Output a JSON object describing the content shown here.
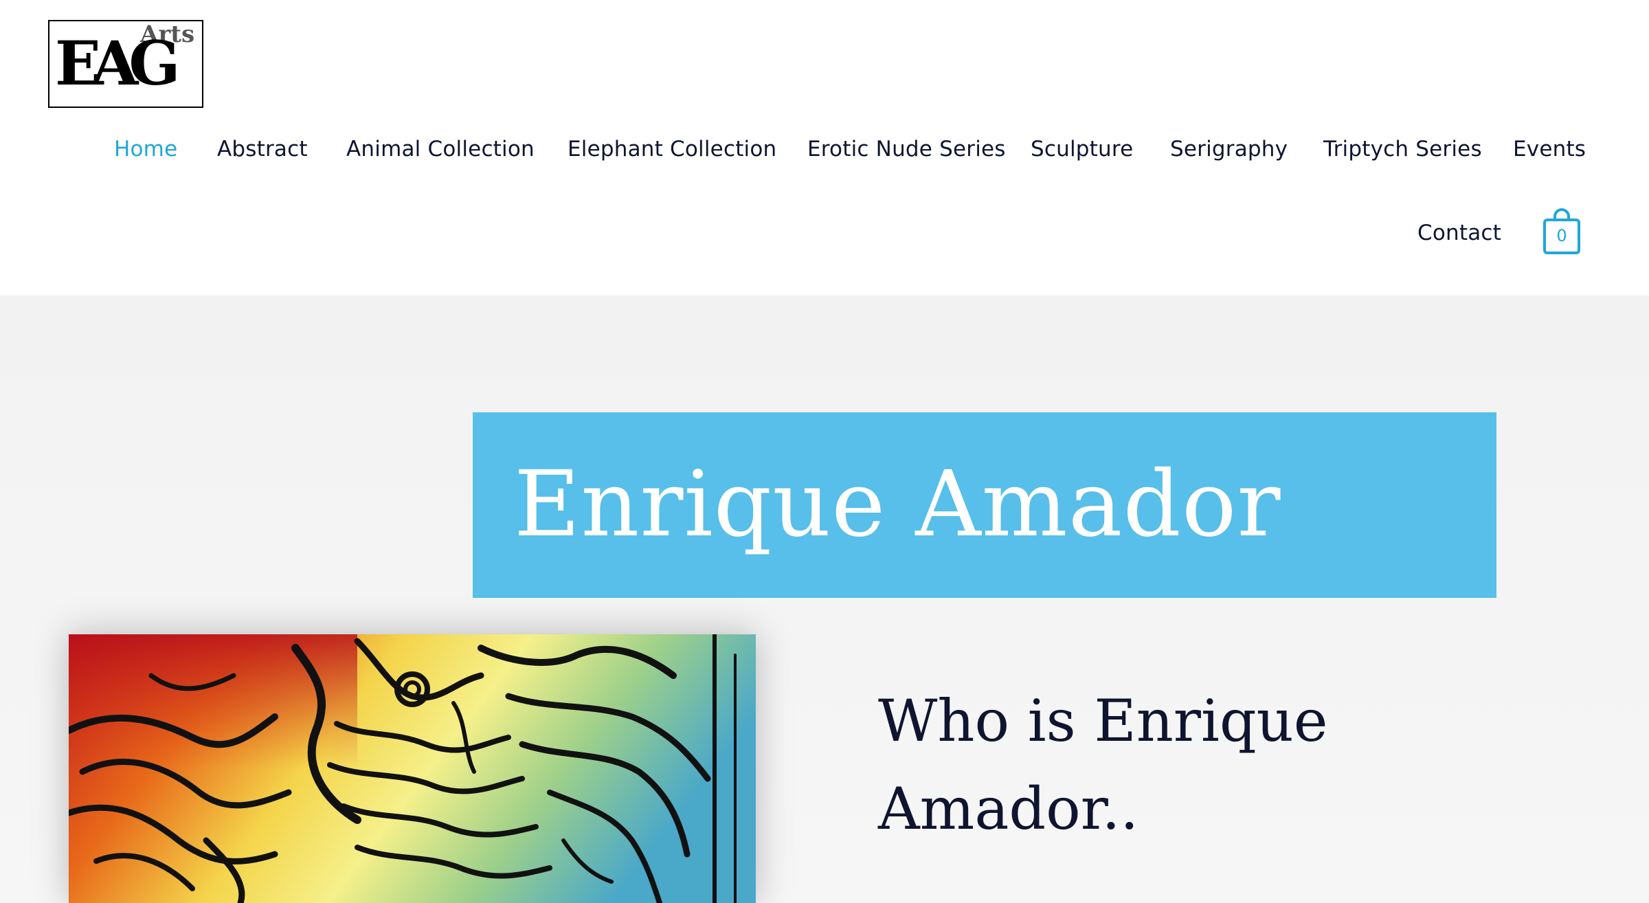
{
  "logo": {
    "big_text": "EAG",
    "small_text": "Arts"
  },
  "nav": {
    "items": [
      {
        "label": "Home",
        "active": true
      },
      {
        "label": "Abstract"
      },
      {
        "label": "Animal Collection"
      },
      {
        "label": "Elephant Collection"
      },
      {
        "label": "Erotic Nude Series"
      },
      {
        "label": "Sculpture"
      },
      {
        "label": "Serigraphy"
      },
      {
        "label": "Triptych Series"
      },
      {
        "label": "Events"
      },
      {
        "label": "Contact"
      }
    ],
    "cart_icon": "shopping-bag-icon",
    "cart_count": "0"
  },
  "hero": {
    "title": "Enrique Amador",
    "heading": "Who is Enrique Amador.."
  },
  "colors": {
    "accent": "#1ea8d8",
    "title_bg": "#57bfe9",
    "text_dark": "#0f1530",
    "hero_bg": "#f3f3f3"
  }
}
